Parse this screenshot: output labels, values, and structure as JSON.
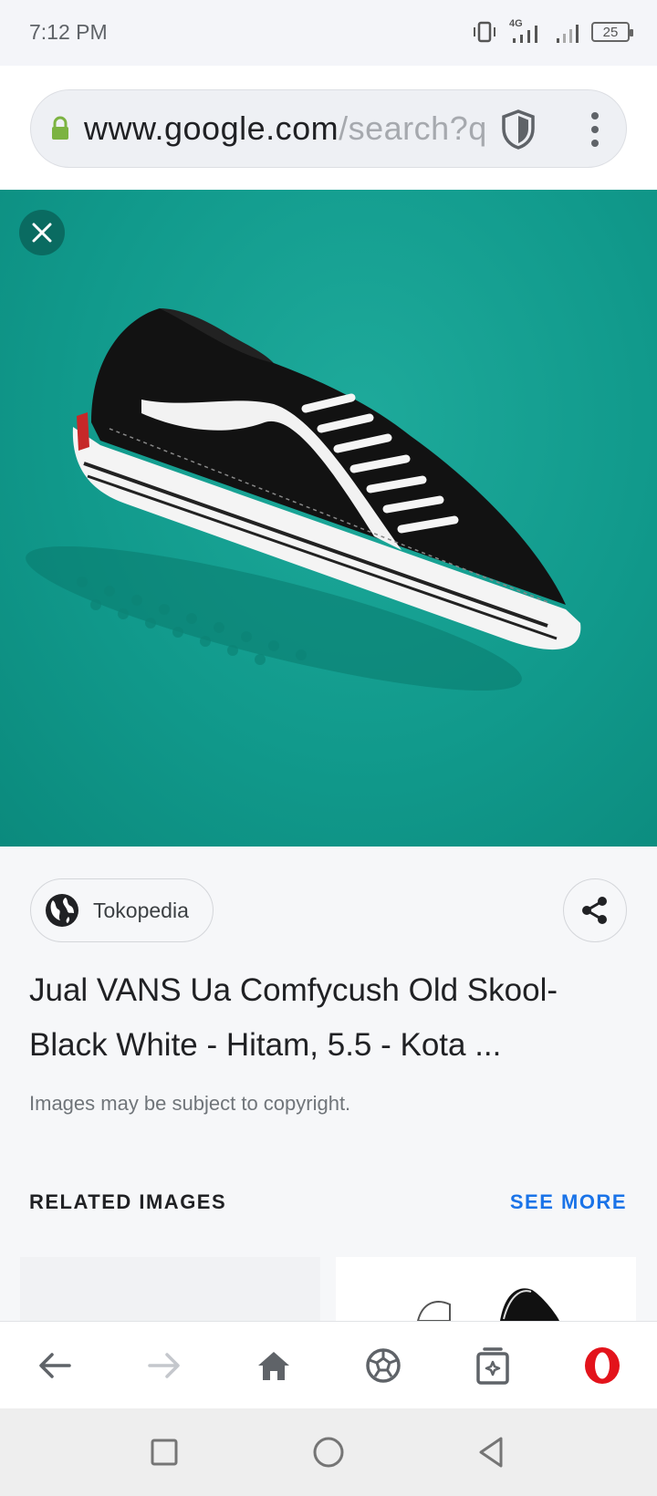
{
  "status_bar": {
    "time": "7:12 PM",
    "network": "4G",
    "battery": "25"
  },
  "browser": {
    "url_host": "www.google.com",
    "url_path": "/search?q",
    "icons": [
      "lock-icon",
      "shield-icon",
      "more-vert-icon"
    ]
  },
  "viewer": {
    "close_icon": "close-icon",
    "image_subject": "shoe-image"
  },
  "result": {
    "source": "Tokopedia",
    "title": "Jual VANS Ua Comfycush Old Skool-Black White - Hitam, 5.5 - Kota ...",
    "copyright_note": "Images may be subject to copyright."
  },
  "related": {
    "heading": "RELATED IMAGES",
    "see_more": "SEE MORE"
  },
  "bottom_nav": {
    "items": [
      "back-icon",
      "forward-icon",
      "home-icon",
      "soccer-ball-icon",
      "tabs-icon",
      "opera-icon"
    ]
  },
  "system_nav": {
    "items": [
      "recents-icon",
      "home-circle-icon",
      "back-triangle-icon"
    ]
  },
  "colors": {
    "accent_blue": "#1a73e8",
    "opera_red": "#e3131b",
    "teal_background": "#119a8c",
    "lock_green": "#7cb342"
  }
}
